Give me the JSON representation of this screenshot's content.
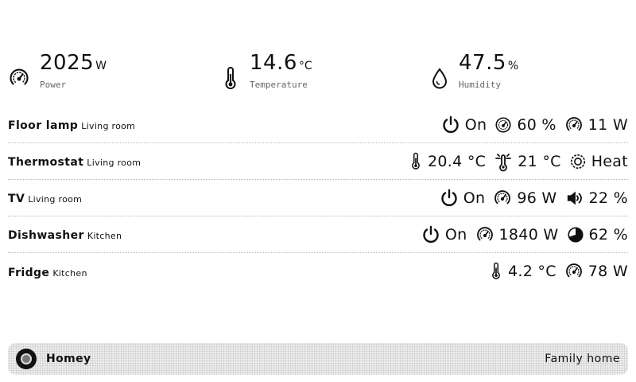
{
  "summary": {
    "power": {
      "value": "2025",
      "unit": "W",
      "label": "Power",
      "icon": "gauge-icon"
    },
    "temperature": {
      "value": "14.6",
      "unit": "°C",
      "label": "Temperature",
      "icon": "thermometer-icon"
    },
    "humidity": {
      "value": "47.5",
      "unit": "%",
      "label": "Humidity",
      "icon": "droplet-icon"
    }
  },
  "devices": [
    {
      "name": "Floor lamp",
      "room": "Living room",
      "capabilities": [
        {
          "icon": "power-icon",
          "value": "On"
        },
        {
          "icon": "dim-icon",
          "value": "60 %"
        },
        {
          "icon": "gauge-icon",
          "value": "11 W"
        }
      ]
    },
    {
      "name": "Thermostat",
      "room": "Living room",
      "capabilities": [
        {
          "icon": "thermometer-icon",
          "value": "20.4 °C"
        },
        {
          "icon": "target-temperature-icon",
          "value": "21 °C"
        },
        {
          "icon": "heat-mode-icon",
          "value": "Heat"
        }
      ]
    },
    {
      "name": "TV",
      "room": "Living room",
      "capabilities": [
        {
          "icon": "power-icon",
          "value": "On"
        },
        {
          "icon": "gauge-icon",
          "value": "96 W"
        },
        {
          "icon": "volume-icon",
          "value": "22 %"
        }
      ]
    },
    {
      "name": "Dishwasher",
      "room": "Kitchen",
      "capabilities": [
        {
          "icon": "power-icon",
          "value": "On"
        },
        {
          "icon": "gauge-icon",
          "value": "1840 W"
        },
        {
          "icon": "progress-pie-icon",
          "value": "62 %"
        }
      ]
    },
    {
      "name": "Fridge",
      "room": "Kitchen",
      "capabilities": [
        {
          "icon": "thermometer-icon",
          "value": "4.2 °C"
        },
        {
          "icon": "gauge-icon",
          "value": "78 W"
        }
      ]
    }
  ],
  "footer": {
    "brand": "Homey",
    "home_name": "Family home",
    "logo_icon": "homey-logo-icon"
  }
}
